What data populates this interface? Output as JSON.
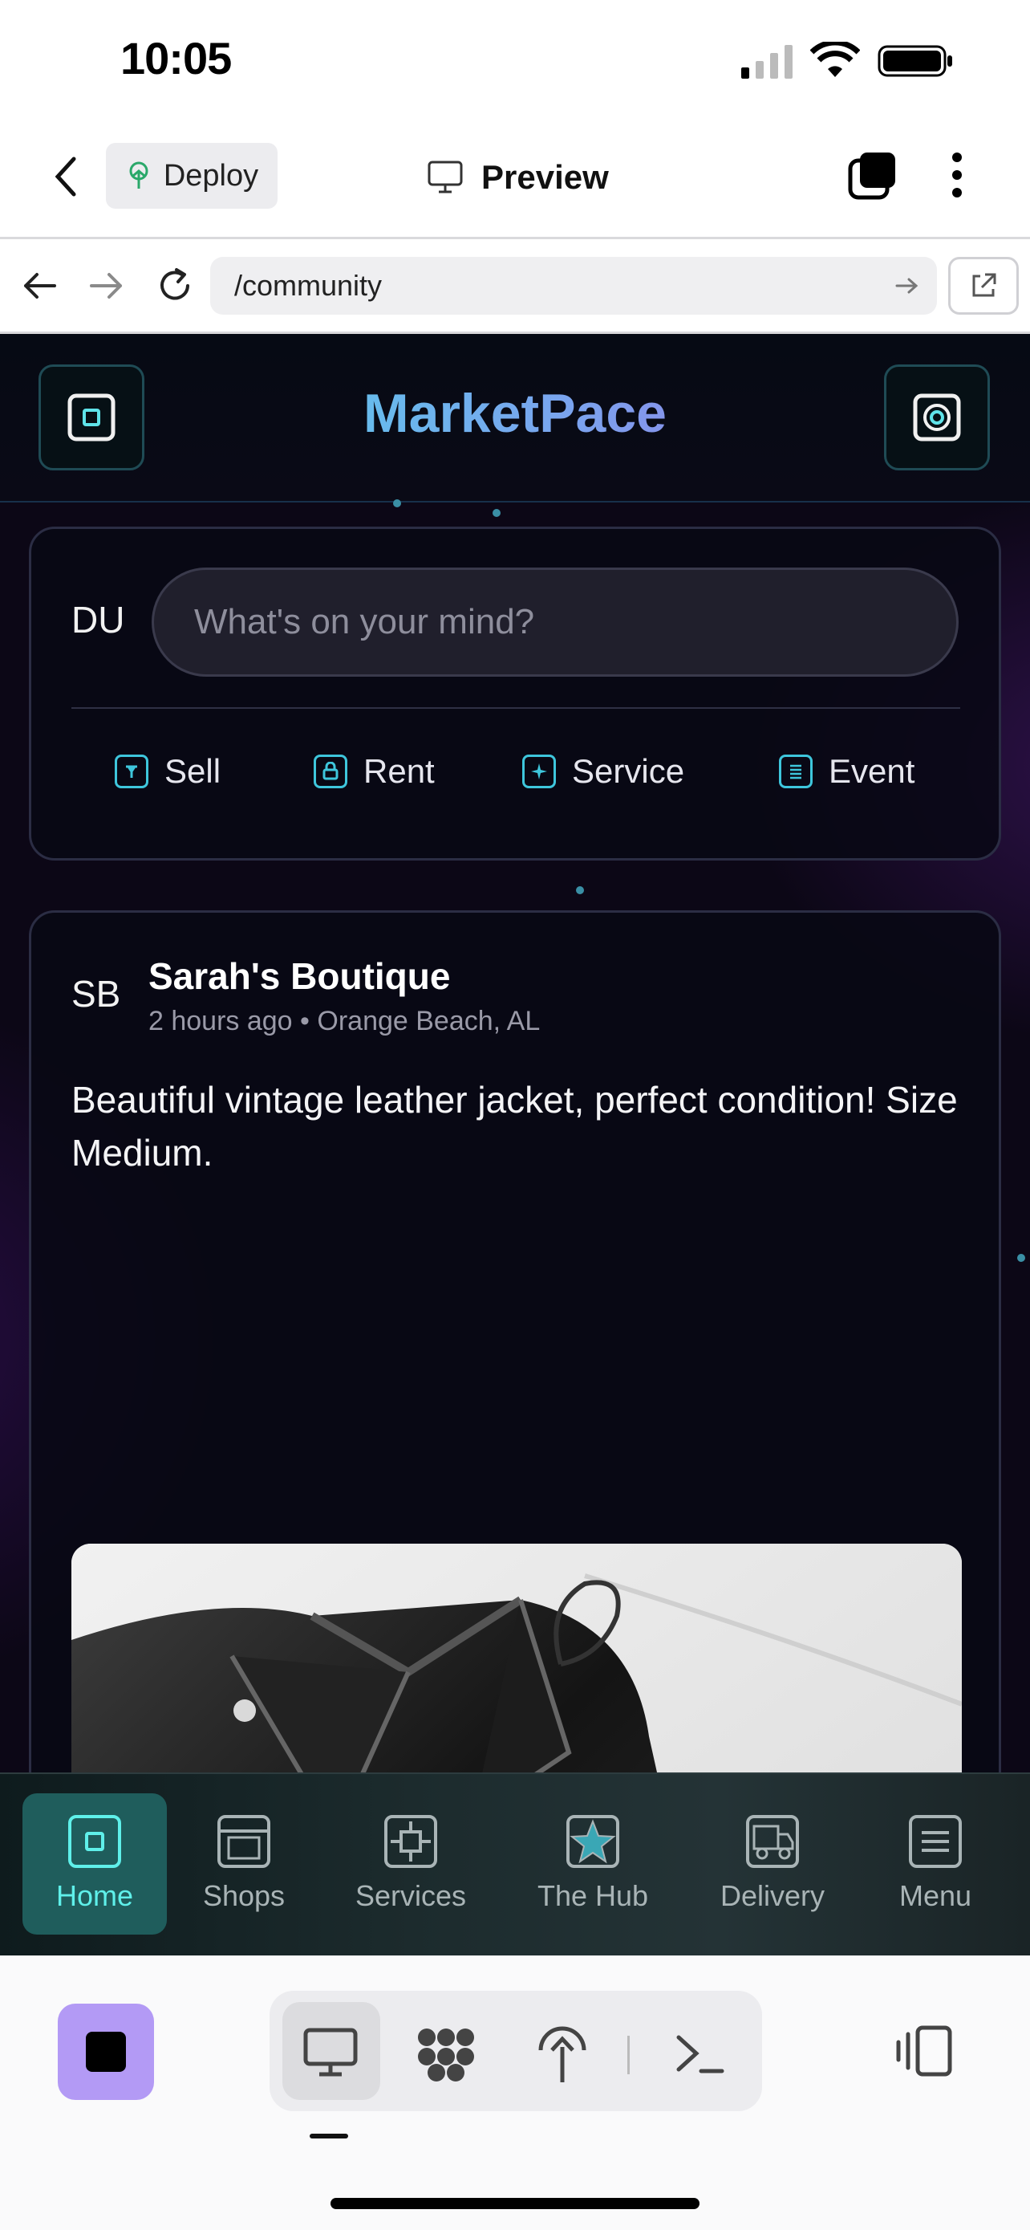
{
  "status_bar": {
    "time": "10:05"
  },
  "toolbar": {
    "deploy_label": "Deploy",
    "preview_label": "Preview"
  },
  "url_bar": {
    "url": "/community"
  },
  "app": {
    "brand": "MarketPace",
    "composer": {
      "initials": "DU",
      "placeholder": "What's on your mind?",
      "actions": [
        {
          "label": "Sell",
          "icon": "tag-icon"
        },
        {
          "label": "Rent",
          "icon": "lock-icon"
        },
        {
          "label": "Service",
          "icon": "sparkle-icon"
        },
        {
          "label": "Event",
          "icon": "list-icon"
        }
      ]
    },
    "post": {
      "initials": "SB",
      "author": "Sarah's Boutique",
      "time": "2 hours ago",
      "location": "Orange Beach, AL",
      "text": "Beautiful vintage leather jacket, perfect condition! Size Medium.",
      "image_alt": "black leather jacket photo"
    },
    "nav": [
      {
        "label": "Home",
        "icon": "home-icon",
        "active": true
      },
      {
        "label": "Shops",
        "icon": "shop-icon",
        "active": false
      },
      {
        "label": "Services",
        "icon": "services-icon",
        "active": false
      },
      {
        "label": "The Hub",
        "icon": "star-icon",
        "active": false
      },
      {
        "label": "Delivery",
        "icon": "truck-icon",
        "active": false
      },
      {
        "label": "Menu",
        "icon": "menu-icon",
        "active": false
      }
    ]
  },
  "colors": {
    "accent": "#5ff0ea",
    "brand_start": "#4fd8ea",
    "brand_end": "#9d6ee3",
    "stop_button": "#b39af5"
  }
}
